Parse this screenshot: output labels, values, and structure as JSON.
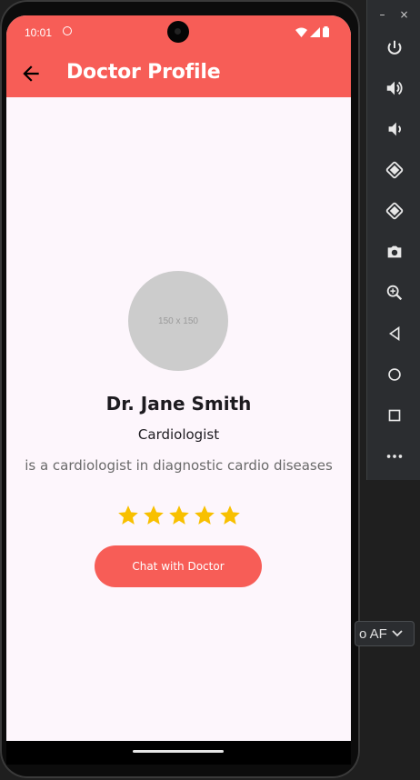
{
  "status_bar": {
    "time": "10:01"
  },
  "app_bar": {
    "title": "Doctor Profile"
  },
  "doctor": {
    "photo_placeholder": "150 x 150",
    "name": "Dr. Jane Smith",
    "specialty": "Cardiologist",
    "bio": "is a cardiologist in diagnostic cardio diseases",
    "rating": 5,
    "rating_max": 5
  },
  "actions": {
    "chat_label": "Chat with Doctor"
  },
  "emulator": {
    "minimize_label": "–",
    "close_label": "×",
    "api_selector_value": "o AF",
    "tools": [
      "power-icon",
      "volume-up-icon",
      "volume-down-icon",
      "rotate-left-icon",
      "rotate-right-icon",
      "camera-icon",
      "zoom-icon",
      "back-icon",
      "home-icon",
      "overview-icon",
      "more-icon"
    ]
  },
  "colors": {
    "primary": "#f75d57",
    "background": "#fdf6fc",
    "star": "#f8c000"
  }
}
